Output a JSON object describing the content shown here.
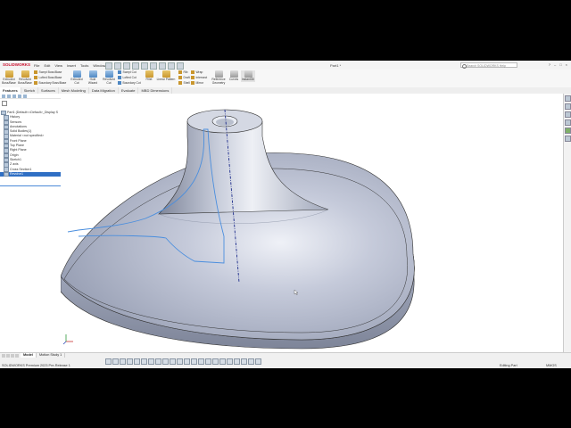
{
  "app": {
    "brand": "SOLIDWORKS",
    "document_title": "Part1 *",
    "search_placeholder": "Search SOLIDWORKS Help",
    "window_controls": [
      "?",
      "–",
      "□",
      "×"
    ]
  },
  "menu": [
    "File",
    "Edit",
    "View",
    "Insert",
    "Tools",
    "Window"
  ],
  "command_manager": {
    "tools": [
      {
        "label": "Extruded Boss/Base"
      },
      {
        "label": "Revolved Boss/Base"
      },
      {
        "label": "Extruded Cut"
      },
      {
        "label": "Hole Wizard"
      },
      {
        "label": "Revolved Cut"
      },
      {
        "label": "Fillet"
      },
      {
        "label": "Linear Pattern"
      },
      {
        "label": "Reference Geometry"
      },
      {
        "label": "Curves"
      },
      {
        "label": "Instant3D"
      }
    ],
    "mini_tools": [
      {
        "label": "Swept Boss/Base"
      },
      {
        "label": "Lofted Boss/Base"
      },
      {
        "label": "Boundary Boss/Base"
      },
      {
        "label": "Swept Cut"
      },
      {
        "label": "Lofted Cut"
      },
      {
        "label": "Boundary Cut"
      },
      {
        "label": "Rib"
      },
      {
        "label": "Draft"
      },
      {
        "label": "Shell"
      },
      {
        "label": "Wrap"
      },
      {
        "label": "Intersect"
      },
      {
        "label": "Mirror"
      }
    ]
  },
  "tabs": [
    {
      "label": "Features",
      "active": true
    },
    {
      "label": "Sketch",
      "active": false
    },
    {
      "label": "Surfaces",
      "active": false
    },
    {
      "label": "Mesh Modeling",
      "active": false
    },
    {
      "label": "Data Migration",
      "active": false
    },
    {
      "label": "Evaluate",
      "active": false
    },
    {
      "label": "MBD Dimensions",
      "active": false
    }
  ],
  "feature_tree": {
    "root": "Part1 (Default<<Default>_Display S",
    "items": [
      {
        "label": "History"
      },
      {
        "label": "Sensors"
      },
      {
        "label": "Annotations"
      },
      {
        "label": "Solid Bodies(1)"
      },
      {
        "label": "Material <not specified>"
      },
      {
        "label": "Front Plane"
      },
      {
        "label": "Top Plane"
      },
      {
        "label": "Right Plane"
      },
      {
        "label": "Origin"
      },
      {
        "label": "Sketch1"
      },
      {
        "label": "Z axis"
      },
      {
        "label": "Cross Section1"
      },
      {
        "label": "Revolve1",
        "selected": true
      }
    ]
  },
  "bottom_tabs": [
    {
      "label": "Model",
      "active": true
    },
    {
      "label": "Motion Study 1",
      "active": false
    }
  ],
  "status_bar": {
    "version": "SOLIDWORKS Premium 2023 Pre-Release 1",
    "mode": "Editing Part",
    "units": "MMGS"
  },
  "colors": {
    "part_body": "#a9b1c7",
    "selection": "#2f6fc4",
    "edge": "#333333",
    "highlight_curve": "#4a8ede"
  }
}
